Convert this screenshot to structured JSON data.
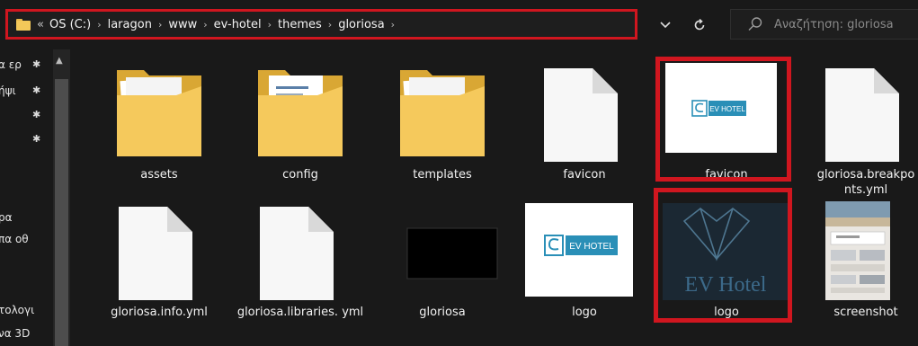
{
  "address_bar": {
    "prefix": "«",
    "crumbs": [
      "OS (C:)",
      "laragon",
      "www",
      "ev-hotel",
      "themes",
      "gloriosa"
    ],
    "separator": "›"
  },
  "nav": {
    "dropdown_icon": "chevron-down-icon",
    "refresh_icon": "refresh-icon"
  },
  "search": {
    "placeholder": "Αναζήτηση: gloriosa"
  },
  "sidebar": {
    "items": [
      {
        "label": "α ερ"
      },
      {
        "label": "ήψι"
      },
      {
        "label": ""
      },
      {
        "label": ""
      },
      {
        "label": "ρα"
      },
      {
        "label": "πα οθ"
      },
      {
        "label": "τολογι"
      },
      {
        "label": "να 3D"
      }
    ]
  },
  "files": [
    {
      "name": "assets",
      "type": "folder"
    },
    {
      "name": "config",
      "type": "folder"
    },
    {
      "name": "templates",
      "type": "folder"
    },
    {
      "name": "favicon",
      "type": "file"
    },
    {
      "name": "favicon",
      "type": "image"
    },
    {
      "name": "gloriosa.breakpoints.yml",
      "display": "gloriosa.breakpo nts.yml",
      "type": "file"
    },
    {
      "name": "gloriosa.info.yml",
      "type": "file"
    },
    {
      "name": "gloriosa.libraries.yml",
      "display": "gloriosa.libraries. yml",
      "type": "file"
    },
    {
      "name": "gloriosa",
      "type": "image"
    },
    {
      "name": "logo",
      "type": "image"
    },
    {
      "name": "logo",
      "type": "image"
    },
    {
      "name": "screenshot",
      "type": "image"
    }
  ],
  "thumbnails": {
    "ev_hotel_small": "EV HOTEL",
    "ev_hotel_large": "EV Hotel"
  },
  "colors": {
    "highlight": "#d0161f",
    "background": "#191919",
    "folder": "#f3c859",
    "ev_blue": "#2a8fb7",
    "logo_dark_bg": "#1b2833"
  }
}
